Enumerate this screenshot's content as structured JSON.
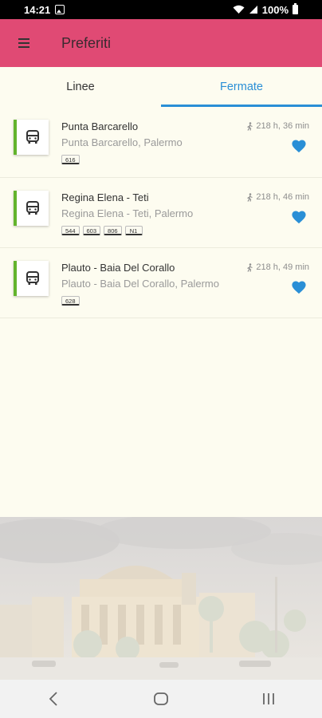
{
  "status_bar": {
    "time": "14:21",
    "battery": "100%",
    "icons": [
      "gallery-icon",
      "wifi-icon",
      "signal-icon",
      "battery-icon"
    ]
  },
  "app_bar": {
    "title": "Preferiti",
    "menu_icon": "menu-icon",
    "background": "#e04a74"
  },
  "tabs": [
    {
      "label": "Linee",
      "selected": false
    },
    {
      "label": "Fermate",
      "selected": true
    }
  ],
  "accent_color": "#2a8fd6",
  "stops": [
    {
      "name": "Punta Barcarello",
      "subtitle": "Punta Barcarello, Palermo",
      "walk_time": "218 h, 36 min",
      "lines": [
        "616"
      ],
      "favorite": true
    },
    {
      "name": "Regina Elena - Teti",
      "subtitle": "Regina Elena - Teti, Palermo",
      "walk_time": "218 h, 46 min",
      "lines": [
        "544",
        "603",
        "806",
        "N1"
      ],
      "favorite": true
    },
    {
      "name": "Plauto - Baia Del Corallo",
      "subtitle": "Plauto - Baia Del Corallo, Palermo",
      "walk_time": "218 h, 49 min",
      "lines": [
        "628"
      ],
      "favorite": true
    }
  ],
  "nav_bar": {
    "buttons": [
      "back-icon",
      "home-icon",
      "recents-icon"
    ]
  }
}
